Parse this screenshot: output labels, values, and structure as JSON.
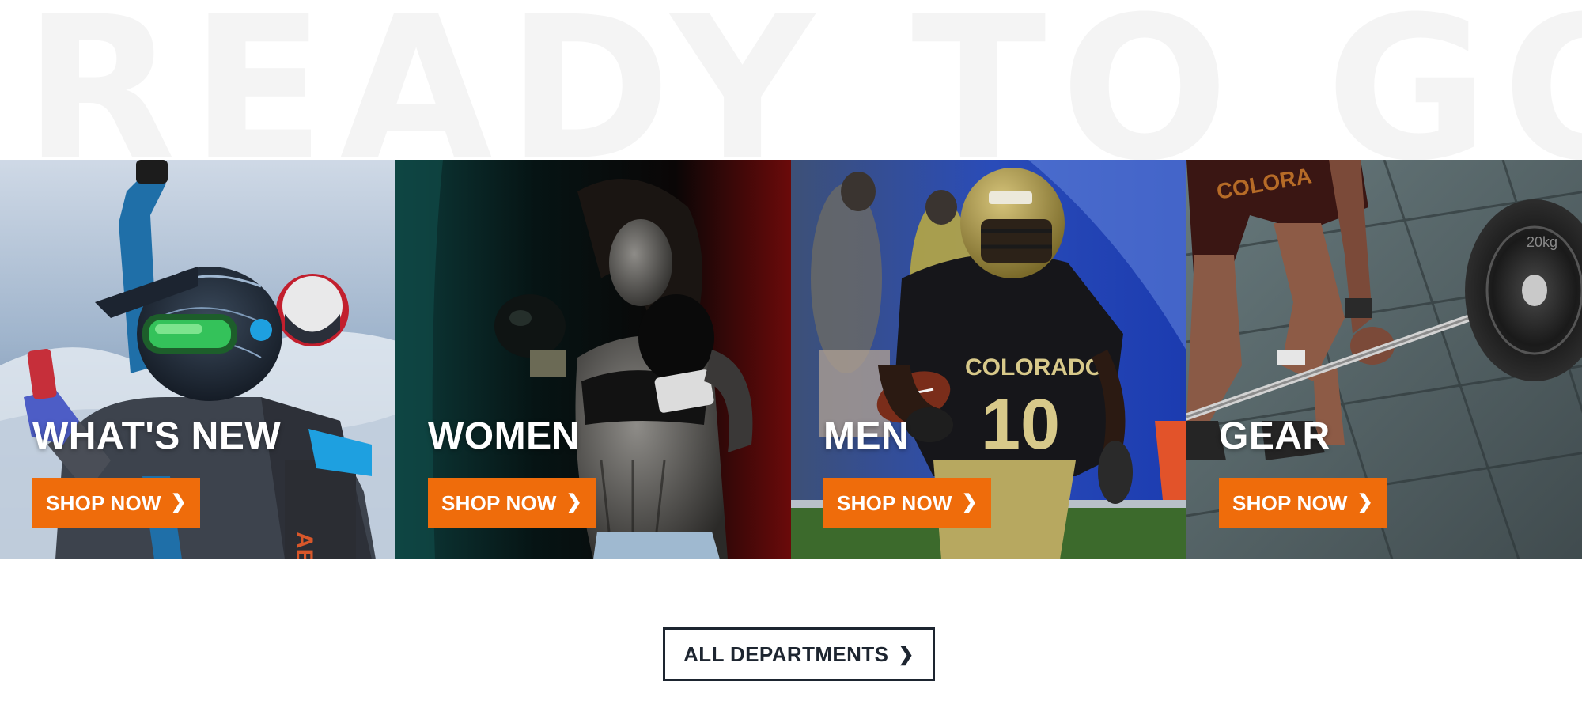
{
  "headline": "READY TO GO",
  "tiles": [
    {
      "title": "WHAT'S NEW",
      "button": "SHOP NOW"
    },
    {
      "title": "WOMEN",
      "button": "SHOP NOW"
    },
    {
      "title": "MEN",
      "button": "SHOP NOW"
    },
    {
      "title": "GEAR",
      "button": "SHOP NOW"
    }
  ],
  "chevron": "❯",
  "all_departments": "ALL DEPARTMENTS",
  "colors": {
    "accent": "#ef6c0b",
    "navy": "#1d2530",
    "headline_ghost": "#f4f4f4"
  },
  "icons": [
    "chevron-right-icon"
  ]
}
